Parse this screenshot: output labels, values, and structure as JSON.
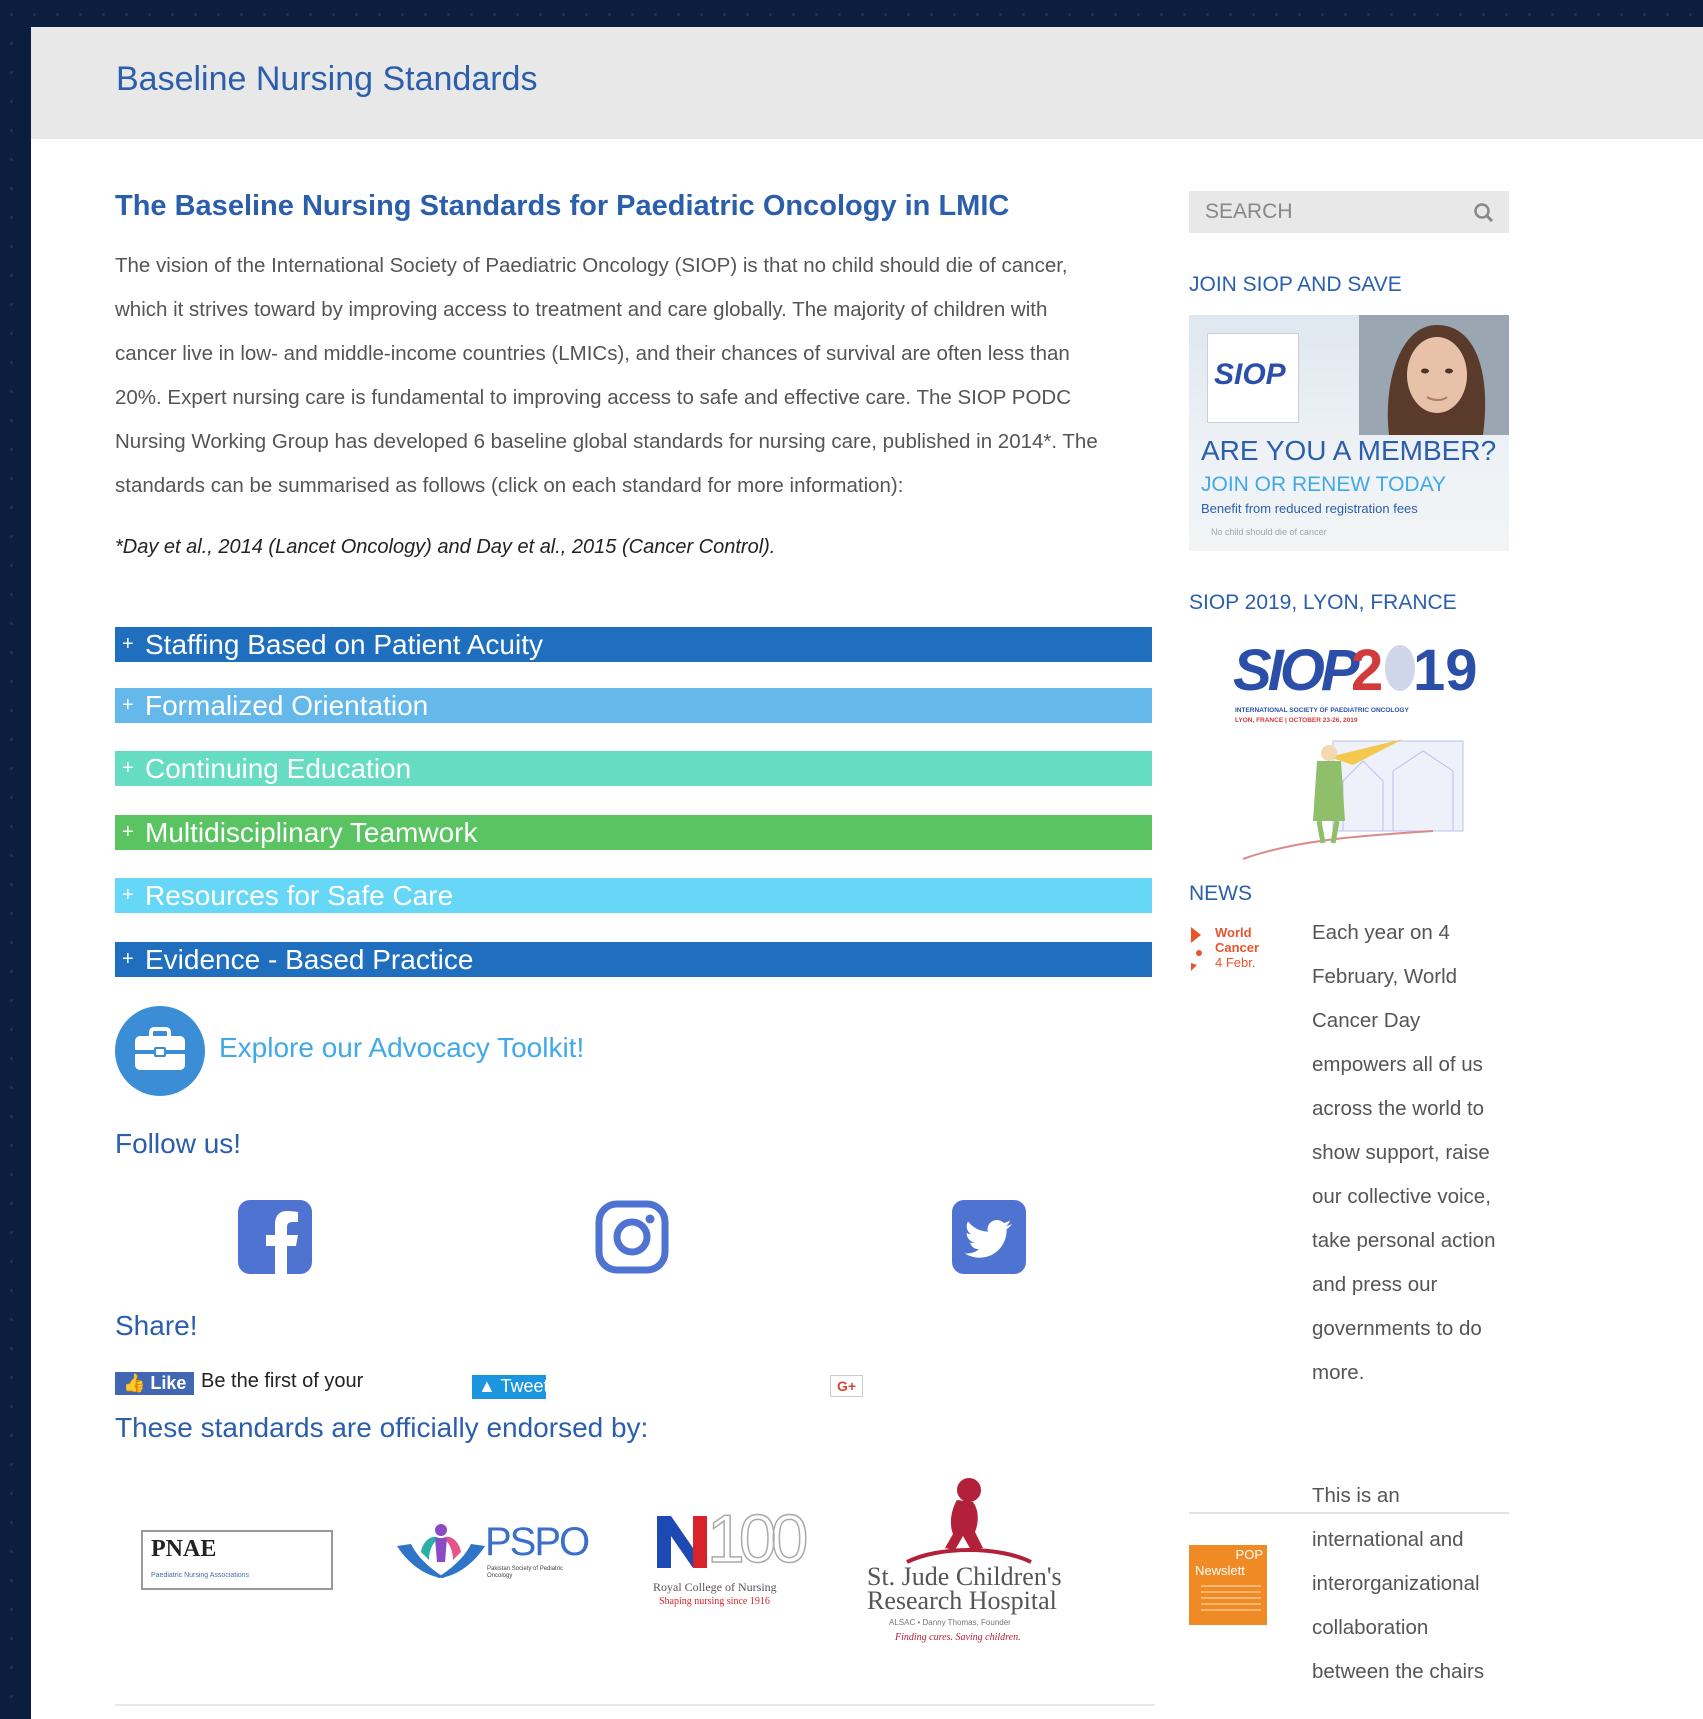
{
  "site": {
    "title": "Baseline Nursing Standards"
  },
  "main": {
    "heading": "The Baseline Nursing Standards for Paediatric Oncology in LMIC",
    "intro": [
      "The vision of the International Society of Paediatric Oncology (SIOP) is that no child should die of cancer,",
      "which it strives toward by improving access to treatment and care globally. The majority of children with",
      "cancer live in low- and middle-income countries (LMICs), and their chances of survival are often less than",
      "20%. Expert nursing care is fundamental to improving access to safe and effective care. The SIOP PODC",
      "Nursing Working Group has developed 6 baseline global standards for nursing care, published in 2014*. The",
      "standards can be summarised as follows (click on each standard for more information):"
    ],
    "citation": "*Day et al., 2014 (Lancet Oncology) and Day et al., 2015 (Cancer Control).",
    "standards": [
      {
        "label": "Staffing Based on Patient Acuity",
        "color": "#1f6fbe"
      },
      {
        "label": "Formalized Orientation",
        "color": "#64b8ea"
      },
      {
        "label": "Continuing Education",
        "color": "#66dcc2"
      },
      {
        "label": "Multidisciplinary Teamwork",
        "color": "#5ac462"
      },
      {
        "label": "Resources for Safe Care",
        "color": "#67d7f7"
      },
      {
        "label": "Evidence - Based Practice",
        "color": "#1f6fbe"
      }
    ],
    "plus_glyph": "+",
    "toolkit_label": "Explore our Advocacy Toolkit!",
    "follow_heading": "Follow us!",
    "share_heading": "Share!",
    "share": {
      "like": "Like",
      "like_text": "Be the first of your",
      "tweet": "Tweet",
      "gplus": "G+"
    },
    "endorsed_heading": "These standards are officially endorsed by:",
    "endorsers": {
      "pnae": {
        "name": "PNAE",
        "sub": "Paediatric Nursing Associations"
      },
      "pspo": {
        "name": "PSPO",
        "sub": "Pakistan Society of Pediatric Oncology"
      },
      "rcn": {
        "name": "100",
        "line1": "Royal College of Nursing",
        "line2": "Shaping nursing since 1916"
      },
      "stjude": {
        "line1": "St. Jude Children's",
        "line2": "Research Hospital",
        "line3": "ALSAC • Danny Thomas, Founder",
        "line4": "Finding cures. Saving children."
      }
    }
  },
  "sidebar": {
    "search_placeholder": "SEARCH",
    "join_heading": "JOIN SIOP AND SAVE",
    "member_banner": {
      "siop": "SIOP",
      "title": "ARE YOU A MEMBER?",
      "subtitle": "JOIN OR RENEW TODAY",
      "line": "Benefit from reduced registration fees",
      "motto": "No child should die of cancer"
    },
    "congress_heading": "SIOP 2019, LYON, FRANCE",
    "congress_logo": {
      "siop": "SIOP",
      "year_a": "2",
      "year_b": "19",
      "line1": "INTERNATIONAL SOCIETY OF PAEDIATRIC ONCOLOGY",
      "line2": "LYON, FRANCE | OCTOBER 23-26, 2019"
    },
    "news_heading": "NEWS",
    "news": [
      {
        "thumb": [
          "World",
          "Cancer",
          "4 Febr."
        ],
        "lines": [
          "Each year on 4",
          "February, World",
          "Cancer Day",
          "empowers all of us",
          "across the world to",
          "show support, raise",
          "our collective voice,",
          "take personal action",
          "and press our",
          "governments to do",
          "more."
        ]
      },
      {
        "thumb": [
          "POP",
          "Newslett"
        ],
        "lines": [
          "This is an",
          "international and",
          "interorganizational",
          "collaboration",
          "between the chairs"
        ]
      }
    ]
  },
  "colors": {
    "brand_blue": "#2b5eab",
    "link_blue": "#41a9e6",
    "topbar": "#e8e8e8"
  }
}
